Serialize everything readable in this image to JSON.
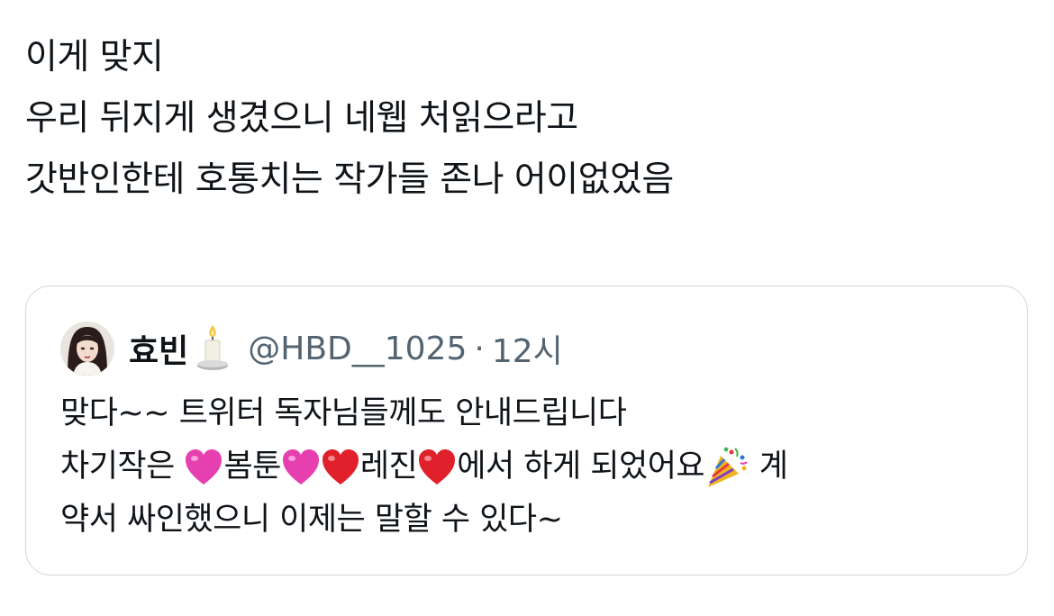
{
  "tweet": {
    "lines": [
      "이게 맞지",
      "우리 뒤지게 생겼으니 네웹 처읽으라고",
      "갓반인한테 호통치는 작가들 존나 어이없었음"
    ]
  },
  "quote": {
    "display_name": "효빈",
    "handle": "@HBD__1025",
    "separator": "·",
    "timestamp": "12시",
    "emojis": {
      "name_badge": "candle-emoji",
      "heart_pink": "pink-heart-emoji",
      "heart_red": "red-heart-emoji",
      "party": "party-popper-emoji"
    },
    "body": {
      "line1": "맞다~~ 트위터 독자님들께도 안내드립니다",
      "line2": {
        "a": "차기작은 ",
        "b": "봄툰",
        "c": "레진",
        "d": "에서 하게 되었어요",
        "e": " 계"
      },
      "line3": "약서 싸인했으니 이제는 말할 수 있다~"
    }
  }
}
